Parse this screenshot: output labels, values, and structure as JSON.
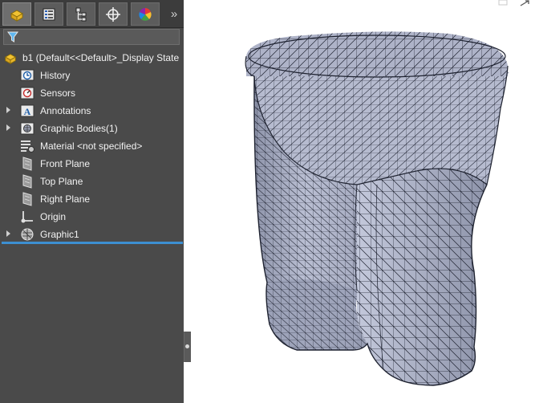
{
  "tabs": [
    {
      "name": "featuremanager-tab",
      "icon": "part-tree-icon"
    },
    {
      "name": "propertymanager-tab",
      "icon": "property-list-icon"
    },
    {
      "name": "configurationmanager-tab",
      "icon": "configuration-tree-icon"
    },
    {
      "name": "dimxpertmanager-tab",
      "icon": "crosshair-target-icon"
    },
    {
      "name": "displaymanager-tab",
      "icon": "color-wheel-icon"
    }
  ],
  "filter": {
    "icon": "filter-icon"
  },
  "tree": {
    "root_label": "b1  (Default<<Default>_Display State",
    "items": [
      {
        "label": "History",
        "icon": "history-icon",
        "expandable": false
      },
      {
        "label": "Sensors",
        "icon": "sensors-icon",
        "expandable": false
      },
      {
        "label": "Annotations",
        "icon": "annotations-icon",
        "expandable": true
      },
      {
        "label": "Graphic Bodies(1)",
        "icon": "graphic-bodies-folder-icon",
        "expandable": true
      },
      {
        "label": "Material <not specified>",
        "icon": "material-icon",
        "expandable": false
      },
      {
        "label": "Front Plane",
        "icon": "plane-icon",
        "expandable": false
      },
      {
        "label": "Top Plane",
        "icon": "plane-icon",
        "expandable": false
      },
      {
        "label": "Right Plane",
        "icon": "plane-icon",
        "expandable": false
      },
      {
        "label": "Origin",
        "icon": "origin-icon",
        "expandable": false
      },
      {
        "label": "Graphic1",
        "icon": "graphic-body-icon",
        "expandable": true
      }
    ]
  },
  "colors": {
    "panel_bg": "#4a4a4a",
    "rollback_bar": "#3d8fd1",
    "mesh_fill": "#b7bccf",
    "mesh_line": "#1e2230"
  }
}
